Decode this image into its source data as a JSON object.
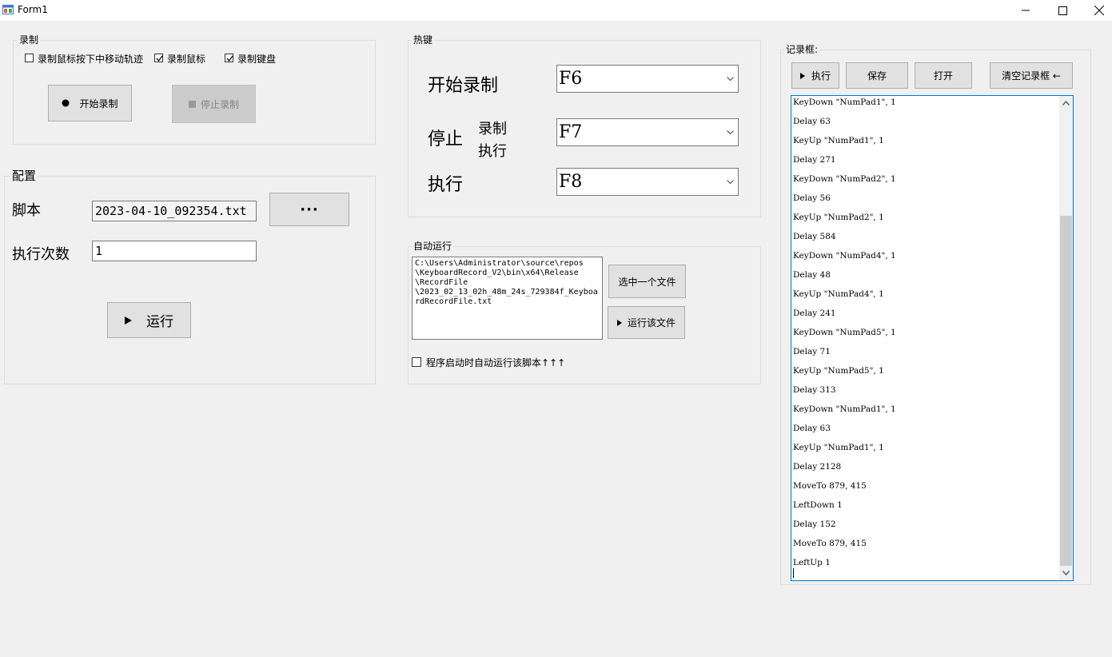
{
  "window": {
    "title": "Form1"
  },
  "record": {
    "group_title": "录制",
    "chk_mouse_track": {
      "label": "录制鼠标按下中移动轨迹",
      "checked": false
    },
    "chk_mouse": {
      "label": "录制鼠标",
      "checked": true
    },
    "chk_keyboard": {
      "label": "录制键盘",
      "checked": true
    },
    "start_button": "开始录制",
    "stop_button": "停止录制"
  },
  "config": {
    "group_title": "配置",
    "script_label": "脚本",
    "script_value": "2023-04-10_092354.txt",
    "browse_button": "···",
    "count_label": "执行次数",
    "count_value": "1",
    "run_button": "运行"
  },
  "hotkeys": {
    "group_title": "热键",
    "start_label": "开始录制",
    "start_value": "F6",
    "stop_label": "停止",
    "stop_sub1": "录制",
    "stop_sub2": "执行",
    "stop_value": "F7",
    "exec_label": "执行",
    "exec_value": "F8"
  },
  "autorun": {
    "group_title": "自动运行",
    "path": "C:\\Users\\Administrator\\source\\repos\n\\KeyboardRecord_V2\\bin\\x64\\Release\n\\RecordFile\n\\2023_02_13_02h_48m_24s_729384f_KeyboardRecordFile.txt",
    "select_button": "选中一个文件",
    "run_file_button": "运行该文件",
    "startup_checkbox": {
      "label": "程序启动时自动运行该脚本↑↑↑",
      "checked": false
    }
  },
  "log": {
    "group_title": "记录框:",
    "exec_button": "执行",
    "save_button": "保存",
    "open_button": "打开",
    "clear_button": "清空记录框 ←",
    "lines": [
      "KeyDown \"NumPad1\", 1",
      "Delay 63",
      "KeyUp \"NumPad1\", 1",
      "Delay 271",
      "KeyDown \"NumPad2\", 1",
      "Delay 56",
      "KeyUp \"NumPad2\", 1",
      "Delay 584",
      "KeyDown \"NumPad4\", 1",
      "Delay 48",
      "KeyUp \"NumPad4\", 1",
      "Delay 241",
      "KeyDown \"NumPad5\", 1",
      "Delay 71",
      "KeyUp \"NumPad5\", 1",
      "Delay 313",
      "KeyDown \"NumPad1\", 1",
      "Delay 63",
      "KeyUp \"NumPad1\", 1",
      "Delay 2128",
      "MoveTo 879, 415",
      "LeftDown 1",
      "Delay 152",
      "MoveTo 879, 415",
      "LeftUp 1"
    ]
  }
}
